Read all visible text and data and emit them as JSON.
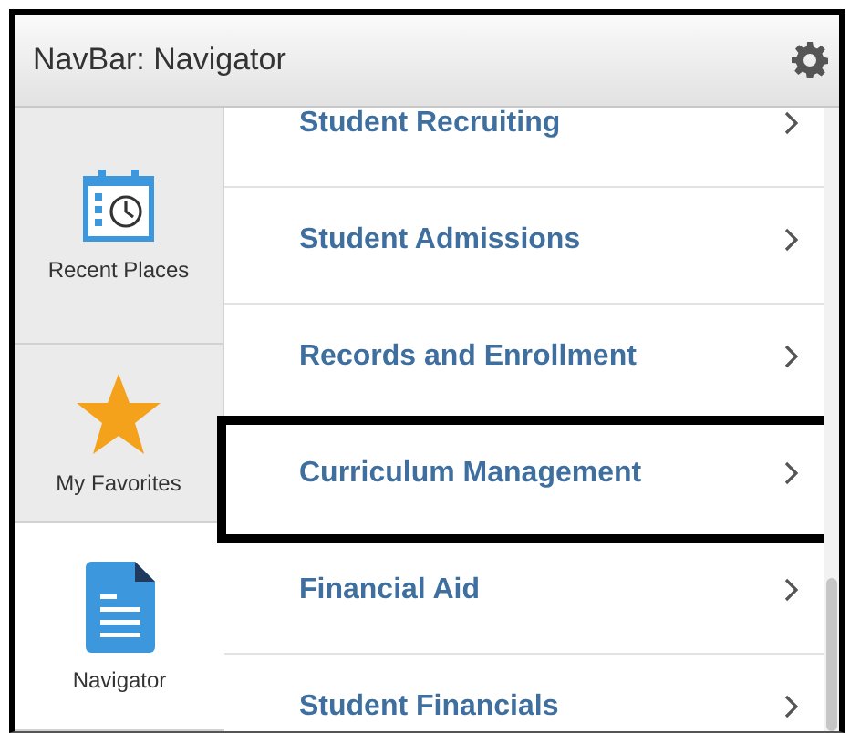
{
  "header": {
    "title": "NavBar: Navigator"
  },
  "sidebar": {
    "items": [
      {
        "kind": "recent",
        "label": "Recent Places",
        "selected": false
      },
      {
        "kind": "favorites",
        "label": "My Favorites",
        "selected": false
      },
      {
        "kind": "navigator",
        "label": "Navigator",
        "selected": true
      }
    ]
  },
  "menu": {
    "items": [
      {
        "label": "Student Recruiting",
        "highlighted": false
      },
      {
        "label": "Student Admissions",
        "highlighted": false
      },
      {
        "label": "Records and Enrollment",
        "highlighted": false
      },
      {
        "label": "Curriculum Management",
        "highlighted": true
      },
      {
        "label": "Financial Aid",
        "highlighted": false
      },
      {
        "label": "Student Financials",
        "highlighted": false
      }
    ]
  }
}
